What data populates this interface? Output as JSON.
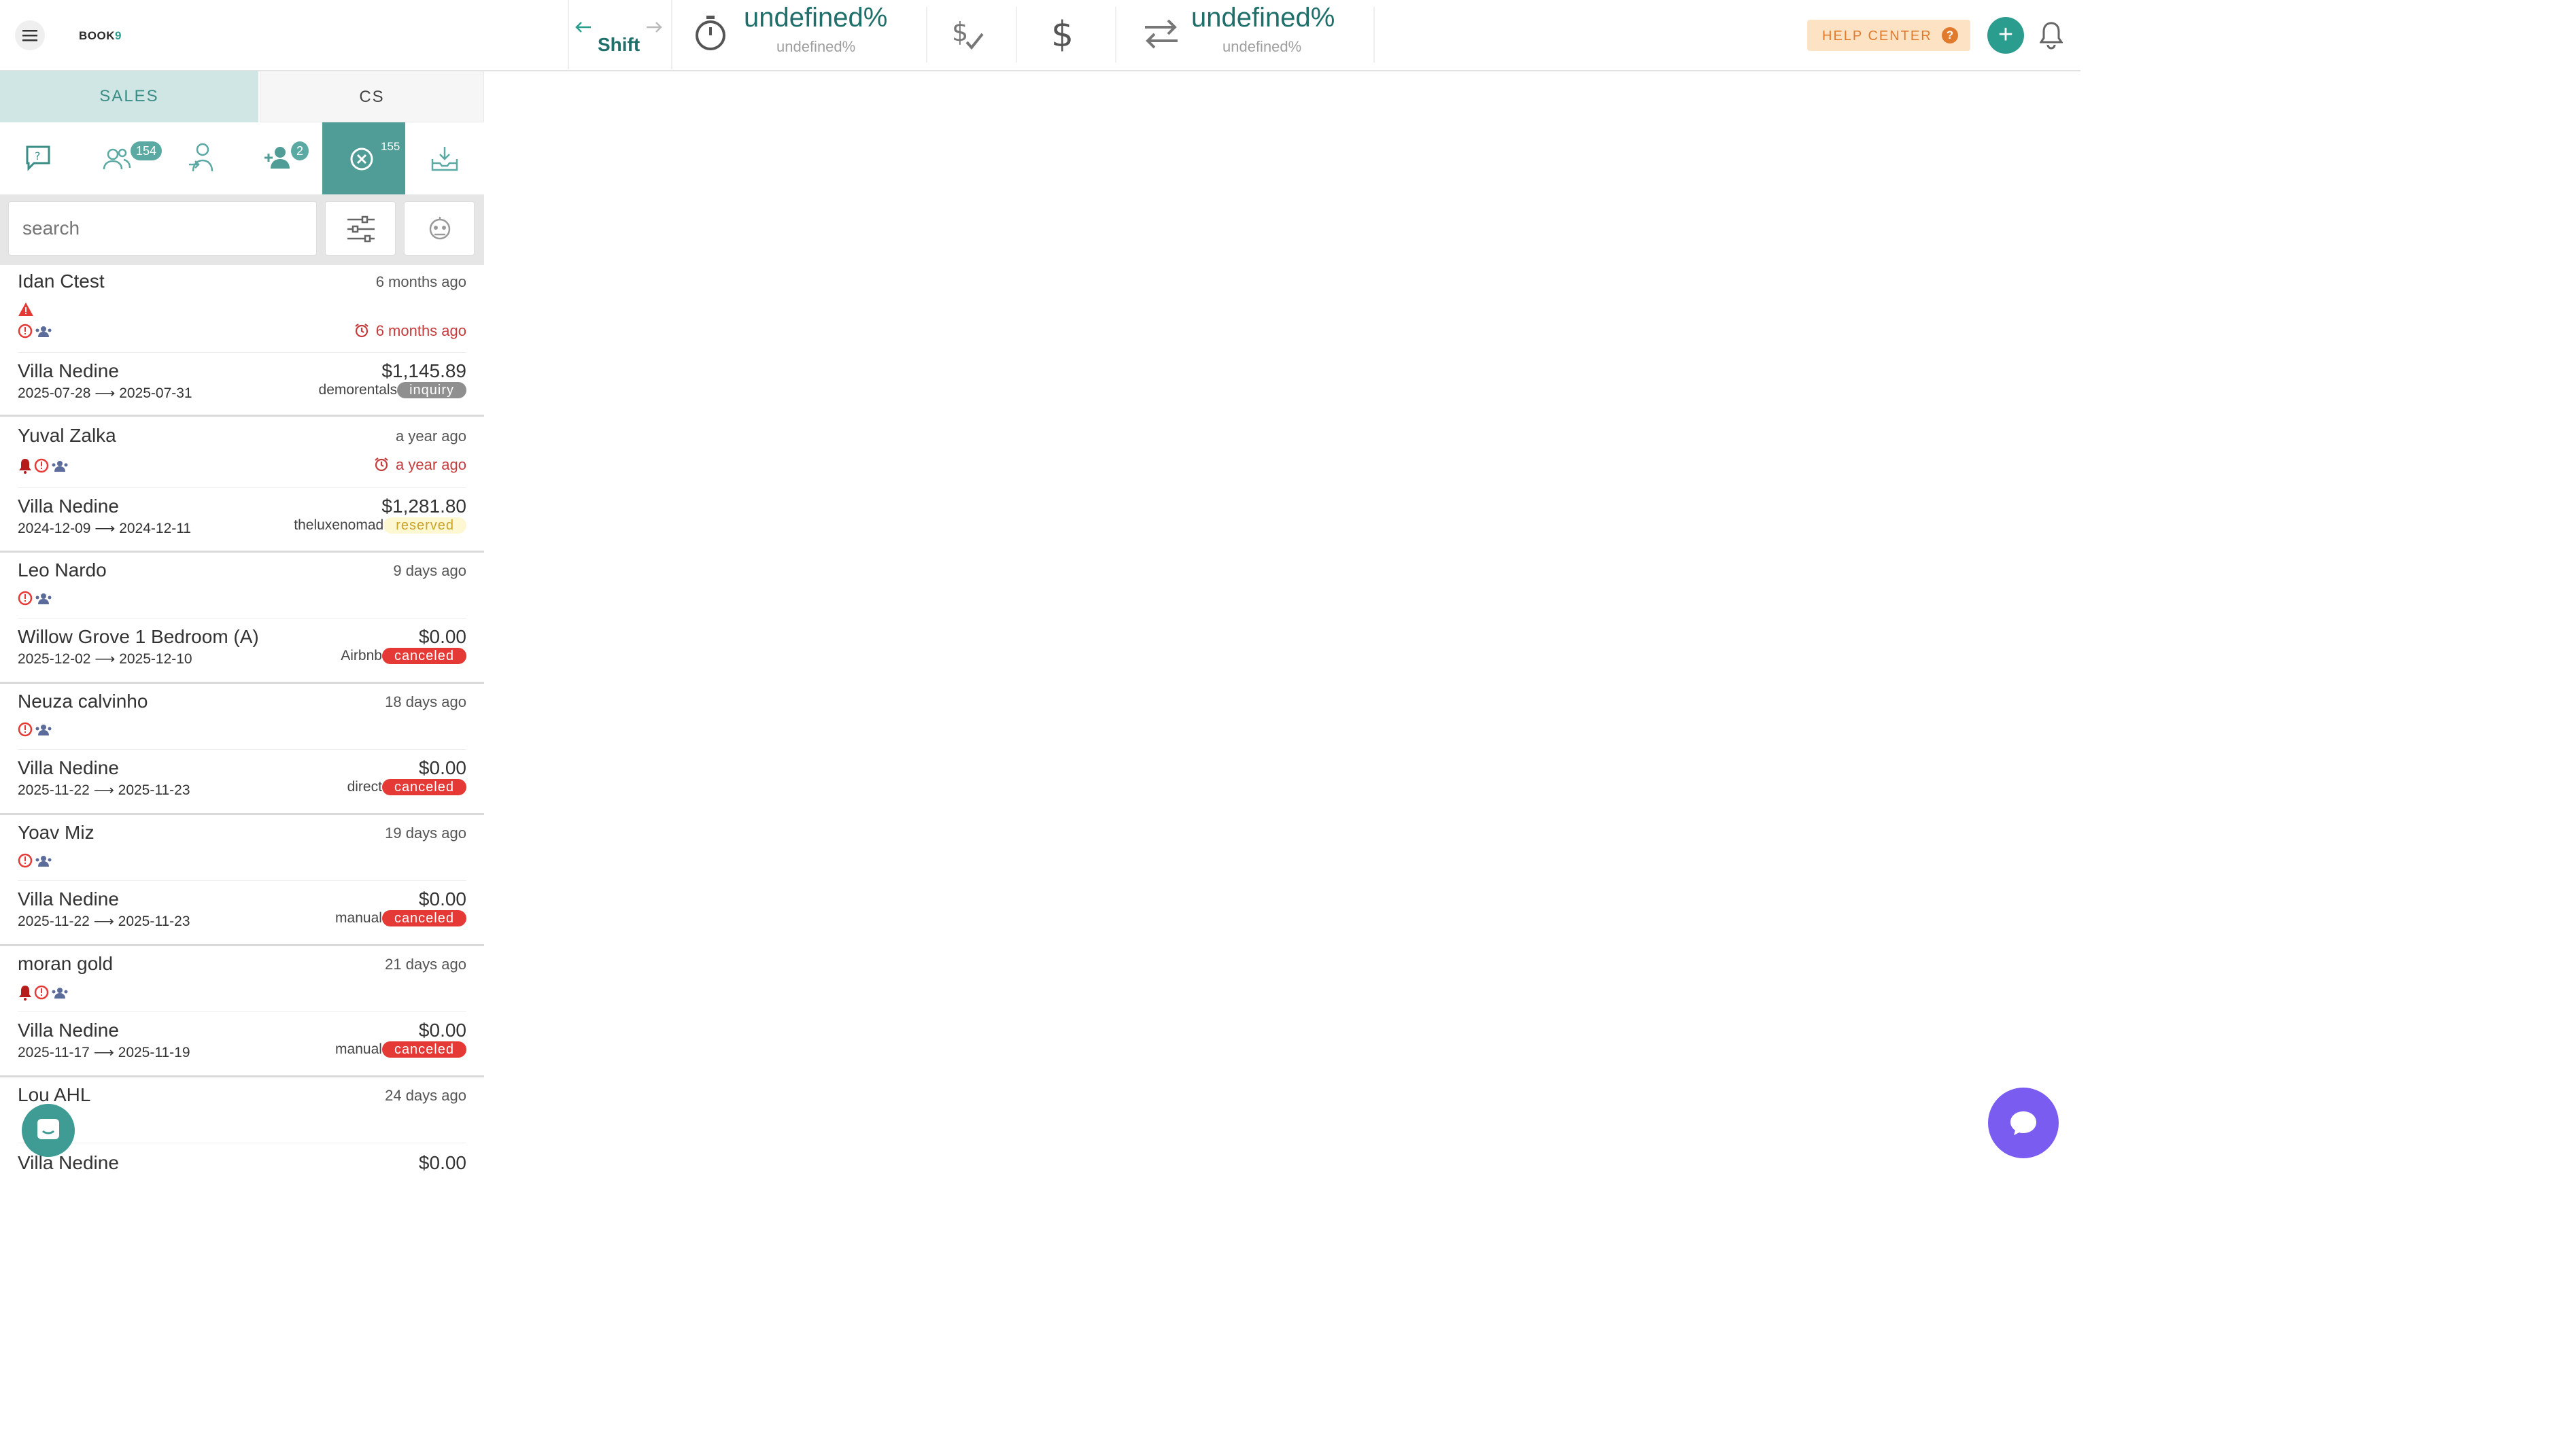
{
  "app": {
    "logo_text": "BOOK",
    "logo_accent": "9"
  },
  "header": {
    "shift_label": "Shift",
    "stat1": {
      "value": "undefined%",
      "sub": "undefined%"
    },
    "stat2": {
      "value": "undefined%",
      "sub": "undefined%"
    },
    "help_label": "HELP CENTER",
    "help_icon": "?",
    "add_label": "+"
  },
  "tabs": {
    "sales": "SALES",
    "cs": "CS"
  },
  "icon_row": {
    "leads_badge": "154",
    "add_guest_badge": "2",
    "canceled_badge": "155"
  },
  "search": {
    "placeholder": "search"
  },
  "conversations": [
    {
      "guest": "Idan Ctest",
      "time_ago": "6 months ago",
      "alert_ago": "6 months ago",
      "property": "Villa Nedine",
      "price": "$1,145.89",
      "dates": "2025-07-28 ⟶ 2025-07-31",
      "channel": "demorentals",
      "status": "inquiry"
    },
    {
      "guest": "Yuval Zalka",
      "time_ago": "a year ago",
      "alert_ago": "a year ago",
      "property": "Villa Nedine",
      "price": "$1,281.80",
      "dates": "2024-12-09 ⟶ 2024-12-11",
      "channel": "theluxenomad",
      "status": "reserved"
    },
    {
      "guest": "Leo Nardo",
      "time_ago": "9 days ago",
      "property": "Willow Grove 1 Bedroom (A)",
      "price": "$0.00",
      "dates": "2025-12-02 ⟶ 2025-12-10",
      "channel": "Airbnb",
      "status": "canceled"
    },
    {
      "guest": "Neuza calvinho",
      "time_ago": "18 days ago",
      "property": "Villa Nedine",
      "price": "$0.00",
      "dates": "2025-11-22 ⟶ 2025-11-23",
      "channel": "direct",
      "status": "canceled"
    },
    {
      "guest": "Yoav Miz",
      "time_ago": "19 days ago",
      "property": "Villa Nedine",
      "price": "$0.00",
      "dates": "2025-11-22 ⟶ 2025-11-23",
      "channel": "manual",
      "status": "canceled"
    },
    {
      "guest": "moran gold",
      "time_ago": "21 days ago",
      "property": "Villa Nedine",
      "price": "$0.00",
      "dates": "2025-11-17 ⟶ 2025-11-19",
      "channel": "manual",
      "status": "canceled"
    },
    {
      "guest": "Lou AHL",
      "time_ago": "24 days ago",
      "property": "Villa Nedine",
      "price": "$0.00"
    }
  ],
  "colors": {
    "teal": "#2a9d8f",
    "teal_dark": "#1f6f6a",
    "canceled": "#e53935",
    "chat": "#7b5cf0"
  }
}
